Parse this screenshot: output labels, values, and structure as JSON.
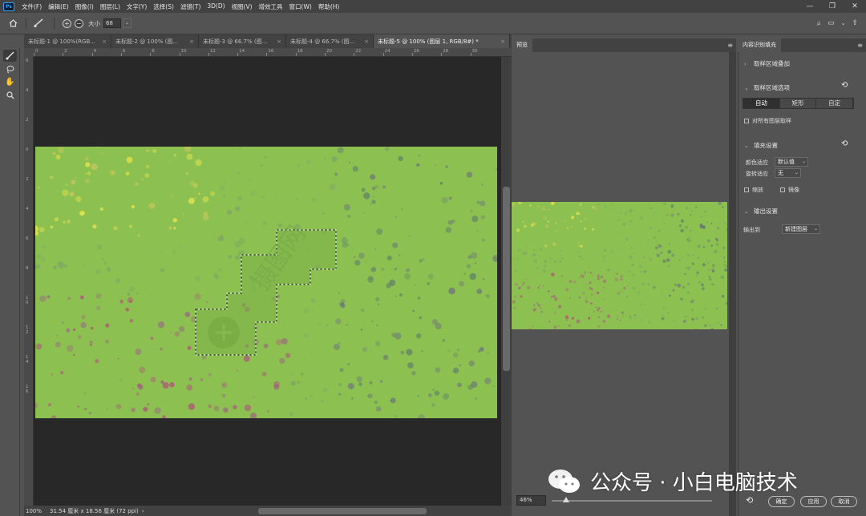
{
  "menu": {
    "items": [
      "文件(F)",
      "编辑(E)",
      "图像(I)",
      "图层(L)",
      "文字(Y)",
      "选择(S)",
      "滤镜(T)",
      "3D(D)",
      "视图(V)",
      "增效工具",
      "窗口(W)",
      "帮助(H)"
    ]
  },
  "window_controls": {
    "minimize": "—",
    "restore": "❐",
    "close": "✕"
  },
  "options_bar": {
    "size_label": "大小",
    "size_value": "68"
  },
  "tabs": [
    {
      "label": "未标题-1 @ 100%(RGB..."
    },
    {
      "label": "未标题-2 @ 100% (图..."
    },
    {
      "label": "未标题-3 @ 66.7% (图..."
    },
    {
      "label": "未标题-4 @ 66.7% (图..."
    },
    {
      "label": "未标题-5 @ 100% (图层 1, RGB/8#) *"
    }
  ],
  "ruler_h": [
    "0",
    "2",
    "4",
    "6",
    "8",
    "10",
    "12",
    "14",
    "16",
    "18",
    "20",
    "22",
    "24",
    "26",
    "28",
    "30"
  ],
  "ruler_v": [
    "6",
    "4",
    "2",
    "0",
    "2",
    "4",
    "6",
    "8",
    "1\n0",
    "1\n2",
    "1\n4",
    "1\n6"
  ],
  "status": {
    "zoom": "100%",
    "doc_size": "31.54 厘米 x 18.56 厘米 (72 ppi)",
    "arrow": "›"
  },
  "watermark_overlay": {
    "text": "摄图网"
  },
  "preview_panel": {
    "title": "预览",
    "zoom": "46%"
  },
  "right_panel": {
    "title": "内容识别填充",
    "sample_overlay": "取样区域叠加",
    "sample_options": "取样区域选项",
    "segments": [
      "自动",
      "矩形",
      "自定"
    ],
    "selected_segment": "自动",
    "sample_all_layers": "对所有图层取样",
    "fill_settings": "填充设置",
    "color_adapt_label": "颜色适应",
    "color_adapt_value": "默认值",
    "rotate_adapt_label": "旋转适应",
    "rotate_adapt_value": "无",
    "scale": "缩放",
    "mirror": "镜像",
    "output_settings": "输出设置",
    "output_to_label": "输出到",
    "output_to_value": "新建图层"
  },
  "buttons": {
    "ok": "确定",
    "apply": "应用",
    "cancel": "取消"
  },
  "overlay_watermark": {
    "text": "公众号 · 小白电脑技术"
  },
  "colors": {
    "canvas_green": "#8cc152",
    "app_bg": "#535353",
    "dark": "#282828"
  }
}
